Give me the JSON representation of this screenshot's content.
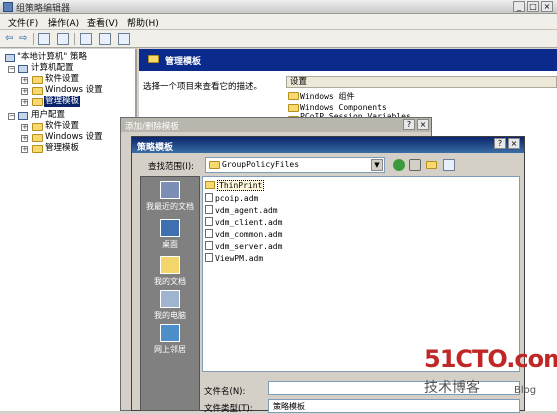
{
  "window": {
    "title": "组策略编辑器"
  },
  "menu": [
    "文件(F)",
    "操作(A)",
    "查看(V)",
    "帮助(H)"
  ],
  "tree": [
    {
      "label": "\"本地计算机\" 策略",
      "type": "root"
    },
    {
      "label": "计算机配置",
      "type": "pc"
    },
    {
      "label": "软件设置",
      "type": "folder"
    },
    {
      "label": "Windows 设置",
      "type": "folder"
    },
    {
      "label": "管理模板",
      "type": "folder",
      "selected": true
    },
    {
      "label": "用户配置",
      "type": "pc"
    },
    {
      "label": "软件设置",
      "type": "folder"
    },
    {
      "label": "Windows 设置",
      "type": "folder"
    },
    {
      "label": "管理模板",
      "type": "folder"
    }
  ],
  "right": {
    "header": "管理模板",
    "description": "选择一个项目来查看它的描述。",
    "column_header": "设置",
    "settings": [
      "Windows 组件",
      "Windows Components",
      "PCoIP Session Variables"
    ]
  },
  "addremove_dialog": {
    "title": "添加/删除模板"
  },
  "open_dialog": {
    "title": "策略模板",
    "lookin_label": "查找范围(I):",
    "lookin_value": "GroupPolicyFiles",
    "places": [
      "我最近的文档",
      "桌面",
      "我的文档",
      "我的电脑",
      "网上邻居"
    ],
    "files": [
      {
        "name": "ThinPrint",
        "kind": "folder",
        "highlight": true
      },
      {
        "name": "pcoip.adm",
        "kind": "file"
      },
      {
        "name": "vdm_agent.adm",
        "kind": "file"
      },
      {
        "name": "vdm_client.adm",
        "kind": "file"
      },
      {
        "name": "vdm_common.adm",
        "kind": "file"
      },
      {
        "name": "vdm_server.adm",
        "kind": "file"
      },
      {
        "name": "ViewPM.adm",
        "kind": "file"
      }
    ],
    "filename_label": "文件名(N):",
    "filename_value": "",
    "filetype_label": "文件类型(T):",
    "filetype_value": "策略模板"
  },
  "watermark": {
    "site": "51CTO.com",
    "tagline": "技术博客",
    "blog": "Blog"
  },
  "colors": {
    "selection": "#0a246a",
    "header": "#0a2a8c",
    "folder": "#f7d96d"
  },
  "icons": [
    "app-icon",
    "back-icon",
    "forward-icon",
    "up-icon",
    "folder-icon",
    "computer-icon",
    "help-icon"
  ]
}
